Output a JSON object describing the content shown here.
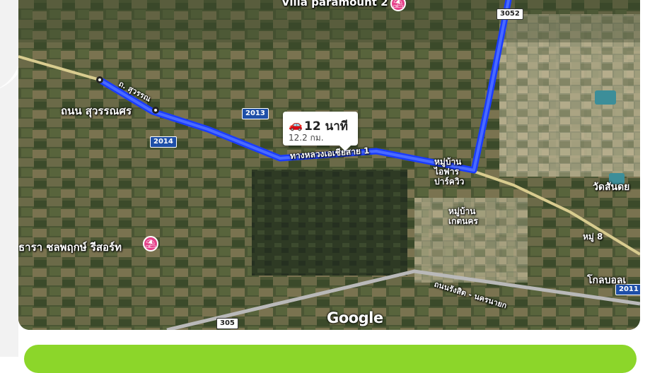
{
  "map": {
    "places": {
      "villa": "Villa paramount 2",
      "start_road": "ถนน สุวรรณศร",
      "small_road": "ถ. สุวรรณ",
      "highway": "ทางหลวงเอเชียสาย 1",
      "village_1": "หมู่บ้าน\nไอฟาร\nปาร์ควิว",
      "village_2": "หมู่บ้าน\nเกตนคร",
      "resort": "ธารา ชลพฤกษ์ รีสอร์ท",
      "temple": "วัดสันดย",
      "moo8": "หมู่ 8",
      "golf": "โกลบอลเ",
      "rangsit_road": "ถนนรังสิต - นครนายก"
    },
    "shields": [
      "3052",
      "2013",
      "2014",
      "2011",
      "305"
    ],
    "route": {
      "time": "12 นาที",
      "distance": "12.2 กม.",
      "color": "#1a3cff"
    },
    "attribution": "Google"
  }
}
